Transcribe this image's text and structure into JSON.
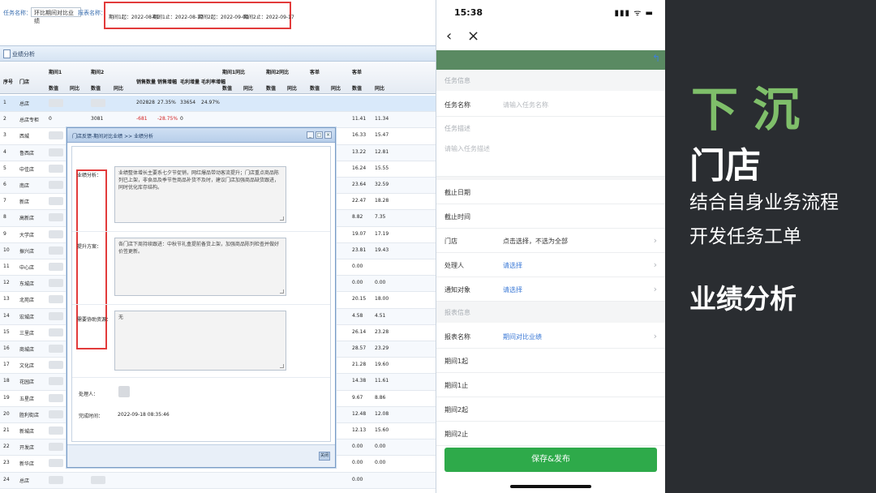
{
  "desktop": {
    "filter1_label": "任务名称：",
    "filter1_value": "环比期间对比业绩",
    "filter2_label": "报表名称：",
    "dates": [
      "期间1起：2022-08-01",
      "期间1止：2022-08-17",
      "期间2起：2022-09-01",
      "期间2止：2022-09-17"
    ],
    "toolbar_label": "业绩分析",
    "headers": {
      "row1": [
        "序号",
        "门店",
        "期间1",
        "期间2",
        "",
        "",
        "",
        "",
        "期间1同比",
        "期间2同比",
        "客单",
        "客单"
      ],
      "row2": [
        "",
        "",
        "数值",
        "同比",
        "数值",
        "同比",
        "销售数量",
        "销售增幅",
        "毛利增量",
        "毛利率增幅",
        "数值",
        "同比",
        "数值",
        "同比",
        "数值",
        "同比",
        "数值",
        "同比"
      ]
    },
    "rows": [
      {
        "no": "1",
        "name": "总店",
        "c1": "",
        "c2": "",
        "c3": "202828",
        "c4": "27.35%",
        "c5": "33654",
        "c6": "24.97%",
        "r1": "",
        "r2": ""
      },
      {
        "no": "2",
        "name": "总店专柜",
        "c1": "0",
        "c2": "3081",
        "c3": "-681",
        "c4": "-28.75%",
        "c5": "0",
        "c6": "",
        "r1": "11.41",
        "r2": "11.34",
        "red": true
      },
      {
        "no": "3",
        "name": "西城",
        "c1": "",
        "c2": "",
        "c3": "",
        "c4": "",
        "c5": "",
        "c6": "",
        "r1": "16.33",
        "r2": "15.47"
      },
      {
        "no": "4",
        "name": "鲁西店",
        "c1": "",
        "c2": "",
        "c3": "",
        "c4": "",
        "c5": "",
        "c6": "",
        "r1": "13.22",
        "r2": "12.81"
      },
      {
        "no": "5",
        "name": "中佳店",
        "c1": "",
        "c2": "",
        "c3": "",
        "c4": "",
        "c5": "",
        "c6": "",
        "r1": "16.24",
        "r2": "15.55"
      },
      {
        "no": "6",
        "name": "南店",
        "c1": "",
        "c2": "",
        "c3": "",
        "c4": "",
        "c5": "",
        "c6": "",
        "r1": "23.64",
        "r2": "32.59"
      },
      {
        "no": "7",
        "name": "新店",
        "c1": "",
        "c2": "",
        "c3": "",
        "c4": "",
        "c5": "",
        "c6": "",
        "r1": "22.47",
        "r2": "18.28"
      },
      {
        "no": "8",
        "name": "高新店",
        "c1": "",
        "c2": "",
        "c3": "",
        "c4": "",
        "c5": "",
        "c6": "",
        "r1": "8.82",
        "r2": "7.35"
      },
      {
        "no": "9",
        "name": "大学店",
        "c1": "",
        "c2": "",
        "c3": "",
        "c4": "",
        "c5": "",
        "c6": "",
        "r1": "19.07",
        "r2": "17.19"
      },
      {
        "no": "10",
        "name": "振兴店",
        "c1": "",
        "c2": "",
        "c3": "",
        "c4": "",
        "c5": "",
        "c6": "",
        "r1": "23.81",
        "r2": "19.43"
      },
      {
        "no": "11",
        "name": "中心店",
        "c1": "",
        "c2": "",
        "c3": "",
        "c4": "",
        "c5": "",
        "c6": "",
        "r1": "0.00",
        "r2": ""
      },
      {
        "no": "12",
        "name": "东城店",
        "c1": "",
        "c2": "",
        "c3": "",
        "c4": "",
        "c5": "",
        "c6": "",
        "r1": "0.00",
        "r2": "0.00"
      },
      {
        "no": "13",
        "name": "北苑店",
        "c1": "",
        "c2": "",
        "c3": "",
        "c4": "",
        "c5": "",
        "c6": "",
        "r1": "20.15",
        "r2": "18.00"
      },
      {
        "no": "14",
        "name": "宏城店",
        "c1": "",
        "c2": "",
        "c3": "",
        "c4": "",
        "c5": "",
        "c6": "",
        "r1": "4.58",
        "r2": "4.51"
      },
      {
        "no": "15",
        "name": "三里店",
        "c1": "",
        "c2": "",
        "c3": "",
        "c4": "",
        "c5": "",
        "c6": "",
        "r1": "26.14",
        "r2": "23.28"
      },
      {
        "no": "16",
        "name": "商城店",
        "c1": "",
        "c2": "",
        "c3": "",
        "c4": "",
        "c5": "",
        "c6": "",
        "r1": "28.57",
        "r2": "23.29"
      },
      {
        "no": "17",
        "name": "文化店",
        "c1": "",
        "c2": "",
        "c3": "",
        "c4": "",
        "c5": "",
        "c6": "",
        "r1": "21.28",
        "r2": "19.60"
      },
      {
        "no": "18",
        "name": "花园店",
        "c1": "",
        "c2": "",
        "c3": "",
        "c4": "",
        "c5": "",
        "c6": "",
        "r1": "14.38",
        "r2": "11.61"
      },
      {
        "no": "19",
        "name": "五星店",
        "c1": "",
        "c2": "",
        "c3": "",
        "c4": "",
        "c5": "",
        "c6": "",
        "r1": "9.67",
        "r2": "8.86"
      },
      {
        "no": "20",
        "name": "胜利街店",
        "c1": "",
        "c2": "",
        "c3": "",
        "c4": "",
        "c5": "",
        "c6": "",
        "r1": "12.48",
        "r2": "12.08"
      },
      {
        "no": "21",
        "name": "新城店",
        "c1": "",
        "c2": "",
        "c3": "",
        "c4": "",
        "c5": "",
        "c6": "",
        "r1": "12.13",
        "r2": "15.60"
      },
      {
        "no": "22",
        "name": "开发店",
        "c1": "",
        "c2": "",
        "c3": "",
        "c4": "",
        "c5": "",
        "c6": "",
        "r1": "0.00",
        "r2": "0.00"
      },
      {
        "no": "23",
        "name": "新华店",
        "c1": "",
        "c2": "",
        "c3": "",
        "c4": "",
        "c5": "",
        "c6": "",
        "r1": "0.00",
        "r2": "0.00"
      },
      {
        "no": "24",
        "name": "总店",
        "c1": "",
        "c2": "",
        "c3": "",
        "c4": "",
        "c5": "",
        "c6": "",
        "r1": "0.00",
        "r2": ""
      }
    ],
    "modal": {
      "title": "门店反馈-期间对比业绩 >> 业绩分析",
      "label1": "业绩分析：",
      "text1": "业绩整体增长主要系七夕节促销，网红爆品带动客流提升；门店重点商品陈列已上架，非食品及季节性商品补货不及时，建议门店加强商品缺货跟进，同时优化库存结构。",
      "label2": "提升方案：",
      "text2": "各门店下周持续跟进：中秋节礼盒提前备货上架，加强商品陈列检查并做好价签更新。",
      "label3": "需要协助资源：",
      "text3": "无",
      "handler_label": "处理人：",
      "time_label": "完成时间：",
      "time_value": "2022-09-18 08:35:46",
      "footer_btn": "关闭"
    }
  },
  "phone": {
    "time": "15:38",
    "status_icons": "▮▮▮ ᯤ ▬",
    "back_icon": "‹",
    "close_icon": "×",
    "green_back": "↰",
    "section_task": "任务信息",
    "task_name_label": "任务名称",
    "task_name_placeholder": "请输入任务名称",
    "task_desc_section": "任务描述",
    "task_desc_placeholder": "请输入任务描述",
    "deadline_date": "截止日期",
    "deadline_time": "截止时间",
    "store_label": "门店",
    "store_value": "点击选择，不选为全部",
    "handler_label": "处理人",
    "handler_value": "请选择",
    "notify_label": "通知对象",
    "notify_value": "请选择",
    "section_report": "报表信息",
    "report_label": "报表名称",
    "report_value": "期间对比业绩",
    "p1_start": "期间1起",
    "p1_end": "期间1止",
    "p2_start": "期间2起",
    "p2_end": "期间2止",
    "save_button": "保存&发布"
  },
  "side": {
    "title": "下沉",
    "subtitle": "门店",
    "line1": "结合自身业务流程",
    "line2": "开发任务工单",
    "perf": "业绩分析"
  },
  "colors": {
    "accent_green": "#7fbf6a",
    "save_green": "#2eaa4a",
    "header_green": "#5a8a62",
    "highlight_red": "#e23b3b",
    "link_blue": "#3b79d6",
    "side_bg": "#2a2d31"
  }
}
